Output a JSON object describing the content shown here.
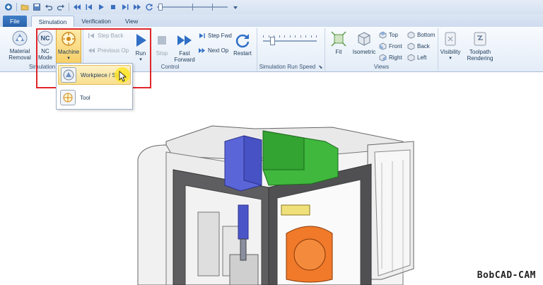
{
  "quick_access": {
    "icons": [
      "app-logo-icon",
      "open-icon",
      "save-icon",
      "undo-icon",
      "redo-icon",
      "rewind-icon",
      "step-back-icon",
      "play-icon",
      "stop-icon",
      "step-forward-icon",
      "fast-forward-icon",
      "restart-icon",
      "speed-slider",
      "customize-icon"
    ]
  },
  "tabs": [
    {
      "label": "File"
    },
    {
      "label": "Simulation"
    },
    {
      "label": "Verification"
    },
    {
      "label": "View"
    }
  ],
  "ribbon": {
    "simulation_group": {
      "label": "Simulation",
      "material_removal": "Material Removal",
      "nc_mode": "NC Mode",
      "nc_icon_text": "NC",
      "machine": "Machine"
    },
    "control_group": {
      "label": "Control",
      "step_back": "Step Back",
      "previous_op": "Previous Op",
      "run": "Run",
      "stop": "Stop",
      "fast_forward": "Fast Forward",
      "step_fwd": "Step Fwd",
      "next_op": "Next Op",
      "restart": "Restart"
    },
    "speed_group": {
      "label": "Simulation Run Speed",
      "speed_level": 0.15
    },
    "views_group": {
      "label": "Views",
      "fit": "Fit",
      "isometric": "Isometric",
      "top": "Top",
      "front": "Front",
      "right": "Right",
      "bottom": "Bottom",
      "back": "Back",
      "left": "Left"
    },
    "other": {
      "visibility": "Visibility",
      "toolpath_rendering": "Toolpath Rendering"
    }
  },
  "machine_dropdown": {
    "items": [
      {
        "label": "Workpiece / Stock"
      },
      {
        "label": "Tool"
      }
    ]
  },
  "watermark": "BobCAD-CAM",
  "colors": {
    "highlight_box": "#e0262b",
    "spindle": "#5a66d8",
    "head": "#3db23d",
    "table": "#f07a2a"
  }
}
